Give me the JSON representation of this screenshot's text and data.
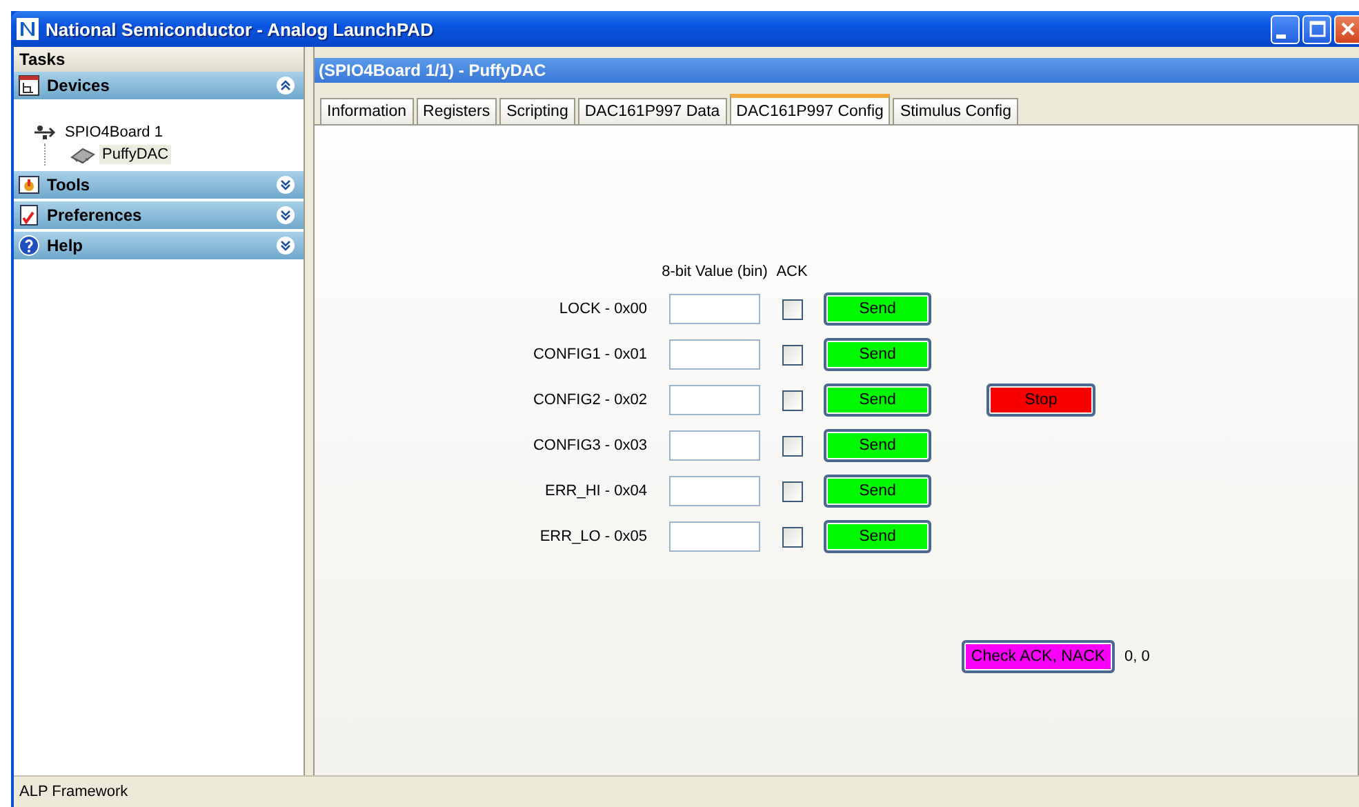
{
  "window": {
    "title": "National Semiconductor - Analog LaunchPAD"
  },
  "sidebar": {
    "title": "Tasks",
    "sections": [
      {
        "label": "Devices",
        "expanded": true,
        "tree": [
          {
            "label": "SPIO4Board 1",
            "selected": false,
            "children": [
              {
                "label": "PuffyDAC",
                "selected": true
              }
            ]
          }
        ]
      },
      {
        "label": "Tools",
        "expanded": false
      },
      {
        "label": "Preferences",
        "expanded": false
      },
      {
        "label": "Help",
        "expanded": false
      }
    ]
  },
  "panel": {
    "title": "(SPIO4Board 1/1) - PuffyDAC",
    "tabs": [
      {
        "label": "Information",
        "selected": false
      },
      {
        "label": "Registers",
        "selected": false
      },
      {
        "label": "Scripting",
        "selected": false
      },
      {
        "label": "DAC161P997 Data",
        "selected": false
      },
      {
        "label": "DAC161P997 Config",
        "selected": true
      },
      {
        "label": "Stimulus Config",
        "selected": false
      }
    ],
    "headers": [
      "8-bit Value (bin)",
      "ACK"
    ],
    "registers": [
      {
        "label": "LOCK - 0x00",
        "ack": false,
        "button": "Send"
      },
      {
        "label": "CONFIG1 - 0x01",
        "ack": false,
        "button": "Send"
      },
      {
        "label": "CONFIG2 - 0x02",
        "ack": false,
        "button": "Send"
      },
      {
        "label": "CONFIG3 - 0x03",
        "ack": false,
        "button": "Send"
      },
      {
        "label": "ERR_HI - 0x04",
        "ack": false,
        "button": "Send"
      },
      {
        "label": "ERR_LO - 0x05",
        "ack": false,
        "button": "Send"
      }
    ],
    "stop_button": "Stop",
    "check_button": "Check ACK, NACK",
    "check_result": "0, 0"
  },
  "status_bar": "ALP Framework"
}
